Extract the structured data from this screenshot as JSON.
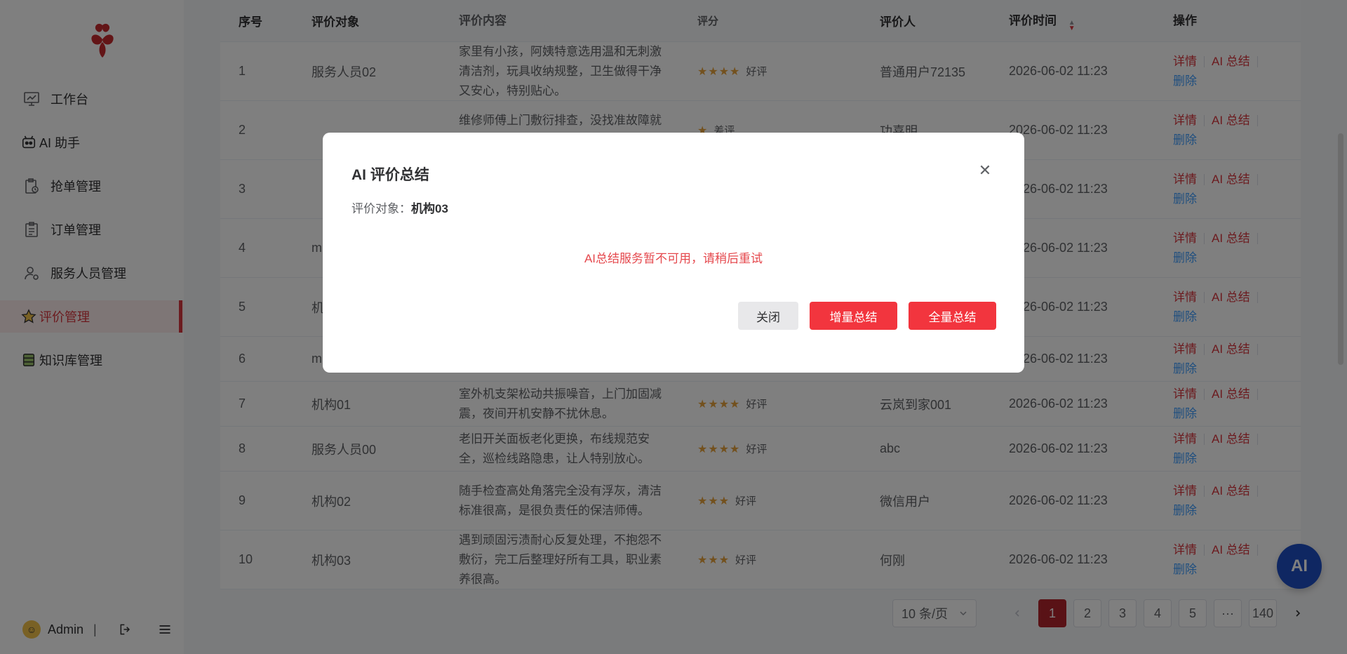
{
  "sidebar": {
    "items": [
      {
        "label": "工作台",
        "icon": "monitor-chart-icon"
      },
      {
        "label": "AI 助手",
        "icon": "robot-face-icon"
      },
      {
        "label": "抢单管理",
        "icon": "clipboard-clock-icon"
      },
      {
        "label": "订单管理",
        "icon": "clipboard-list-icon"
      },
      {
        "label": "服务人员管理",
        "icon": "user-settings-icon"
      },
      {
        "label": "评价管理",
        "icon": "star-icon"
      },
      {
        "label": "知识库管理",
        "icon": "database-icon"
      }
    ],
    "user": {
      "name": "Admin",
      "separator": "|"
    }
  },
  "table": {
    "headers": {
      "idx": "序号",
      "object": "评价对象",
      "content": "评价内容",
      "score": "评分",
      "user": "评价人",
      "time": "评价时间",
      "op": "操作"
    },
    "rows": [
      {
        "idx": "1",
        "object": "服务人员02",
        "content": "家里有小孩，阿姨特意选用温和无刺激清洁剂，玩具收纳规整，卫生做得干净又安心，特别贴心。",
        "stars": "★★★★",
        "rating": "好评",
        "user": "普通用户72135",
        "time": "2026-06-02 11:23"
      },
      {
        "idx": "2",
        "object": "",
        "content": "维修师傅上门敷衍排查，没找准故障就忽悠更换整套水龙头，收费虚高。",
        "stars": "★",
        "rating": "差评",
        "user": "功喜明",
        "time": "2026-06-02 11:23"
      },
      {
        "idx": "3",
        "object": "",
        "content": "",
        "stars": "",
        "rating": "",
        "user": "",
        "time": "2026-06-02 11:23"
      },
      {
        "idx": "4",
        "object": "m",
        "content": "",
        "stars": "",
        "rating": "",
        "user": "",
        "time": "2026-06-02 11:23"
      },
      {
        "idx": "5",
        "object": "机",
        "content": "",
        "stars": "",
        "rating": "",
        "user": "",
        "time": "2026-06-02 11:23"
      },
      {
        "idx": "6",
        "object": "m",
        "content": "",
        "stars": "",
        "rating": "",
        "user": "",
        "time": "2026-06-02 11:23"
      },
      {
        "idx": "7",
        "object": "机构01",
        "content": "室外机支架松动共振噪音，上门加固减震，夜间开机安静不扰休息。",
        "stars": "★★★★",
        "rating": "好评",
        "user": "云岚到家001",
        "time": "2026-06-02 11:23"
      },
      {
        "idx": "8",
        "object": "服务人员00",
        "content": "老旧开关面板老化更换，布线规范安全，巡检线路隐患，让人特别放心。",
        "stars": "★★★★",
        "rating": "好评",
        "user": "abc",
        "time": "2026-06-02 11:23"
      },
      {
        "idx": "9",
        "object": "机构02",
        "content": "随手检查高处角落完全没有浮灰，清洁标准很高，是很负责任的保洁师傅。",
        "stars": "★★★",
        "rating": "好评",
        "user": "微信用户",
        "time": "2026-06-02 11:23"
      },
      {
        "idx": "10",
        "object": "机构03",
        "content": "遇到顽固污渍耐心反复处理，不抱怨不敷衍，完工后整理好所有工具，职业素养很高。",
        "stars": "★★★",
        "rating": "好评",
        "user": "何刚",
        "time": "2026-06-02 11:23"
      }
    ],
    "ops": {
      "detail": "详情",
      "ai_summary": "AI 总结",
      "delete": "删除"
    }
  },
  "pagination": {
    "page_size": "10 条/页",
    "pages": [
      "1",
      "2",
      "3",
      "4",
      "5"
    ],
    "ellipsis": "···",
    "last": "140",
    "current": "1"
  },
  "ai_float_label": "AI",
  "modal": {
    "title": "AI 评价总结",
    "target_label": "评价对象：",
    "target_value": "机构03",
    "message": "AI总结服务暂不可用，请稍后重试",
    "btn_close": "关闭",
    "btn_incremental": "增量总结",
    "btn_full": "全量总结"
  },
  "colors": {
    "accent": "#d9363e",
    "primary_button": "#f2353e",
    "error_text": "#e5484d",
    "link_blue": "#409eff",
    "ai_float": "#1f4fc4",
    "star": "#e6a23c"
  }
}
